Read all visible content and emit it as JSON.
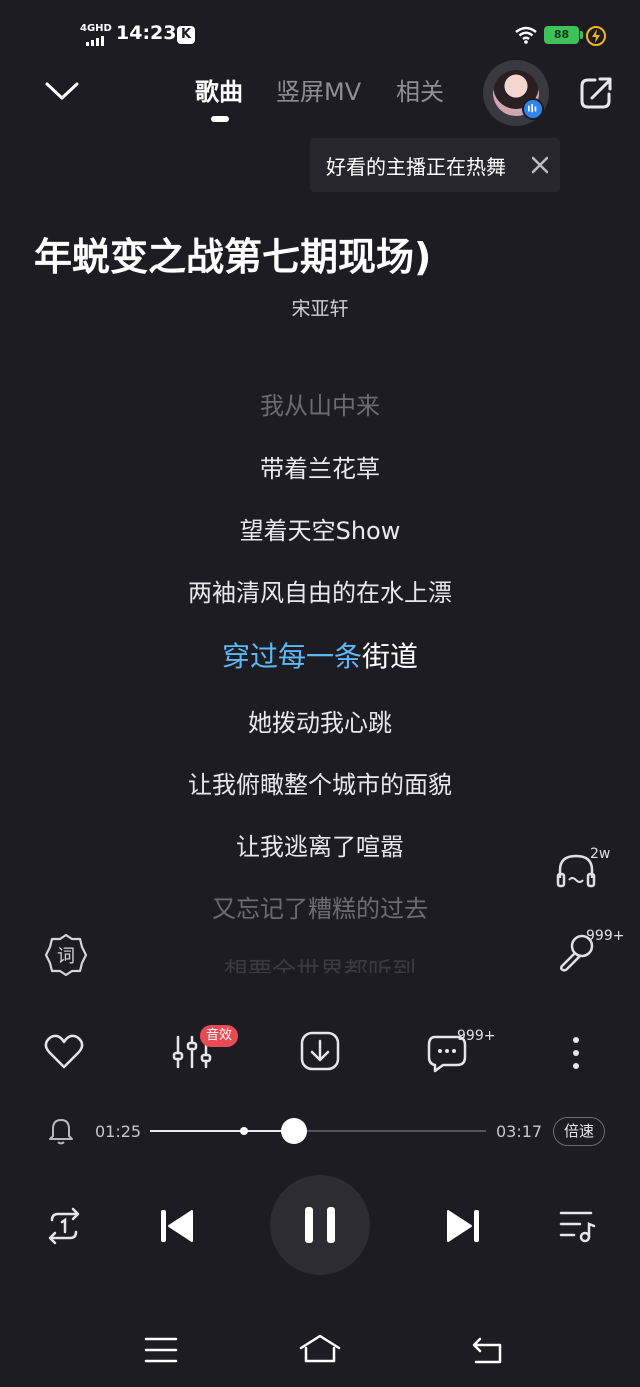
{
  "status_bar": {
    "network": "4GHD",
    "time": "14:23",
    "app_badge": "K",
    "battery": "88"
  },
  "header": {
    "tabs": [
      {
        "label": "歌曲"
      },
      {
        "label": "竖屏MV"
      },
      {
        "label": "相关"
      }
    ],
    "tooltip": "好看的主播正在热舞"
  },
  "song": {
    "title": "年蜕变之战第七期现场)",
    "artist": "宋亚轩"
  },
  "lyrics": {
    "line0": "我从山中来",
    "line1": "带着兰花草",
    "line2": "望着天空Show",
    "line3": "两袖清风自由的在水上漂",
    "active_sung": "穿过每一条",
    "active_rest": "街道",
    "line5": "她拨动我心跳",
    "line6": "让我俯瞰整个城市的面貌",
    "line7": "让我逃离了喧嚣",
    "line8": "又忘记了糟糕的过去",
    "line9": "想要全世界都听到"
  },
  "side": {
    "listen_count": "2w",
    "karaoke_count": "999+",
    "lyric_button": "词"
  },
  "actions": {
    "effect_badge": "音效",
    "comment_count": "999+"
  },
  "progress": {
    "current": "01:25",
    "total": "03:17",
    "fraction": 0.43,
    "speed_label": "倍速"
  },
  "icons": [
    "chevron-down-icon",
    "share-icon",
    "close-icon",
    "headphone-icon",
    "microphone-icon",
    "heart-icon",
    "equalizer-icon",
    "download-icon",
    "comment-icon",
    "more-icon",
    "bell-icon",
    "repeat-one-icon",
    "previous-icon",
    "pause-icon",
    "next-icon",
    "playlist-icon",
    "menu-icon",
    "home-icon",
    "back-icon"
  ],
  "colors": {
    "background": "#1d1c22",
    "lyric_highlight": "#5cb9f5",
    "badge_red": "#e84b54",
    "battery": "#3ec15a"
  }
}
